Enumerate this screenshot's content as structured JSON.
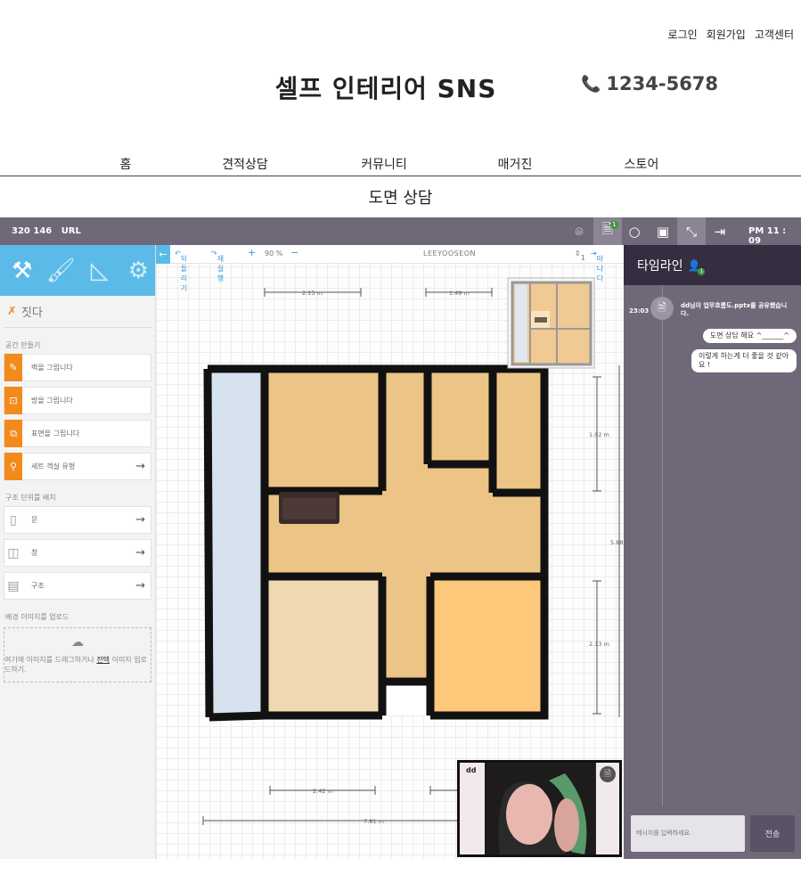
{
  "top_links": [
    "로그인",
    "회원가입",
    "고객센터"
  ],
  "site_title": "셀프 인테리어 SNS",
  "phone": "1234-5678",
  "nav": [
    "홈",
    "견적상담",
    "커뮤니티",
    "매거진",
    "스토어"
  ],
  "page_title": "도면 상담",
  "app": {
    "session_id": "320 146",
    "url_label": "URL",
    "clock": "PM 11 : 09",
    "file_badge": "1",
    "icons": [
      "camera-icon",
      "document-icon",
      "circle-icon",
      "image-icon",
      "collapse-icon",
      "exit-icon"
    ]
  },
  "sidebar": {
    "tools": [
      "hammer-wrench-icon",
      "paintbrush-icon",
      "ruler-triangle-icon",
      "gear-icon"
    ],
    "section_title": "짓다",
    "group1": "공간 만들기",
    "items1": [
      {
        "label": "벽을 그립니다",
        "icon": "wall-pencil-icon",
        "arrow": false
      },
      {
        "label": "방을 그립니다",
        "icon": "room-icon",
        "arrow": false
      },
      {
        "label": "표면을 그립니다",
        "icon": "surface-icon",
        "arrow": false
      },
      {
        "label": "세트 객실 유형",
        "icon": "location-pin-icon",
        "arrow": true
      }
    ],
    "group2": "구조 단위를 배치",
    "items2": [
      {
        "label": "문",
        "icon": "door-icon"
      },
      {
        "label": "창",
        "icon": "window-icon"
      },
      {
        "label": "구조",
        "icon": "stairs-icon"
      }
    ],
    "group3": "배경 이미지를 업로드",
    "upload": {
      "pre": "여기에 이미지를 드래그하거나 ",
      "link": "전택",
      "post": " 이미지 업로드하기."
    }
  },
  "canvas_toolbar": {
    "undo": "되돌리기",
    "redo": "재실행",
    "zoom": "90 %",
    "project": "LEEYOOSEON",
    "page_count": "1",
    "exit": "떠나다"
  },
  "floorplan": {
    "dimensions": [
      "2.15 m",
      "1.49 m",
      "1.92 m",
      "5.88",
      "2.13 m",
      "2.42 m",
      "7.81 m"
    ],
    "colors": {
      "wall": "#111111",
      "room_a": "#ecc486",
      "room_b": "#f0d8b0",
      "room_c": "#fdc87a",
      "blue": "#d6e3ef"
    }
  },
  "timeline": {
    "title": "타임라인",
    "badge": "1",
    "file_msg": {
      "time": "23:03",
      "text": "dd님이 업무흐름도.pptx를 공유했습니다."
    },
    "messages": [
      "도면 상담 해요 ^______^",
      "이렇게 하는게 더 좋을 것 같아요 !"
    ],
    "input_placeholder": "메시지를 입력하세요.",
    "send_label": "전송"
  },
  "video": {
    "user": "dd"
  }
}
